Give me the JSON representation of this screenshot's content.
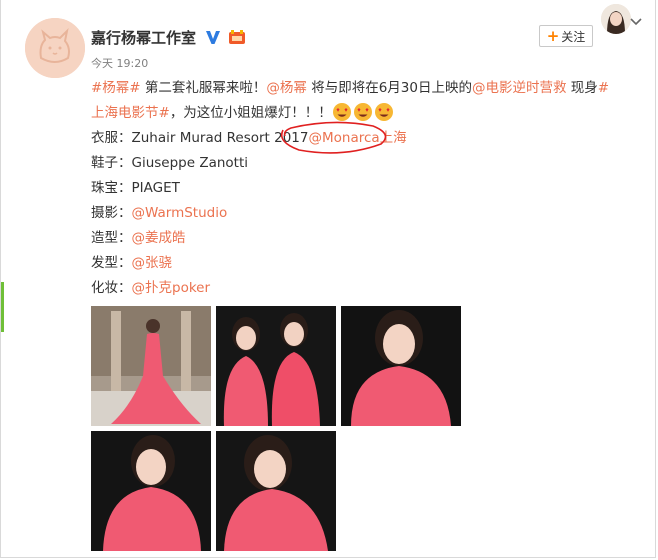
{
  "post": {
    "author": "嘉行杨幂工作室",
    "time": "今天 19:20",
    "follow_label": "关注",
    "verified_icon": "verified-v-icon",
    "vip_icon": "member-badge-icon",
    "line1": {
      "tag1": "#杨幂#",
      "text1": " 第二套礼服幂来啦！",
      "mention1": "@杨幂",
      "text2": " 将与即将在6月30日上映的",
      "mention2": "@电影逆时营救",
      "text3": " 现身",
      "tag2_start": "#"
    },
    "line2": {
      "tag2_end": "上海电影节#",
      "text": "，为这位小姐姐爆灯！！！"
    },
    "credits": [
      {
        "label": "衣服：",
        "value": "Zuhair Murad Resort 2017",
        "mention": "@Monarca上海"
      },
      {
        "label": "鞋子：",
        "value": "Giuseppe Zanotti",
        "mention": ""
      },
      {
        "label": "珠宝：",
        "value": "PIAGET",
        "mention": ""
      },
      {
        "label": "摄影：",
        "value": "",
        "mention": "@WarmStudio"
      },
      {
        "label": "造型：",
        "value": "",
        "mention": "@姜成皓"
      },
      {
        "label": "发型：",
        "value": "",
        "mention": "@张骁"
      },
      {
        "label": "化妆：",
        "value": "",
        "mention": "@扑克poker"
      }
    ],
    "photos_count": 5
  },
  "colors": {
    "link": "#eb7350",
    "dress": "#f0506a",
    "circle": "#e02020",
    "accent": "#ff8200"
  }
}
